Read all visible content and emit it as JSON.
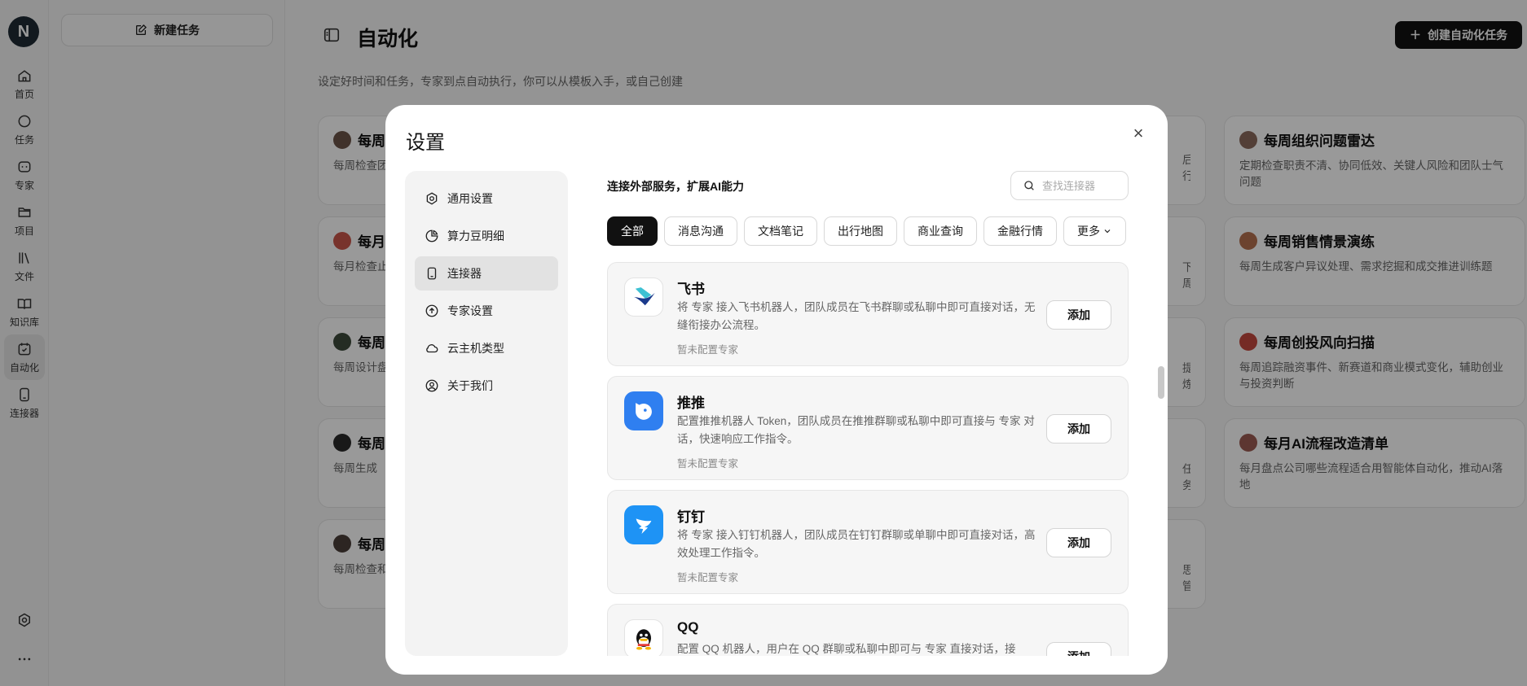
{
  "rail": {
    "logo": "N",
    "items": [
      {
        "label": "首页",
        "icon": "home-icon"
      },
      {
        "label": "任务",
        "icon": "chat-icon"
      },
      {
        "label": "专家",
        "icon": "bot-icon"
      },
      {
        "label": "项目",
        "icon": "folder-icon"
      },
      {
        "label": "文件",
        "icon": "books-icon"
      },
      {
        "label": "知识库",
        "icon": "book-open-icon"
      },
      {
        "label": "自动化",
        "icon": "calendar-check-icon"
      },
      {
        "label": "连接器",
        "icon": "tablet-icon"
      }
    ],
    "active": "自动化",
    "bottom": [
      "settings-icon",
      "more-dots-icon"
    ]
  },
  "sidebar": {
    "new_task": "新建任务"
  },
  "main": {
    "title": "自动化",
    "subtitle": "设定好时间和任务，专家到点自动执行，你可以从模板入手，或自己创建",
    "create_button": "创建自动化任务",
    "cards_left": [
      {
        "title": "每周",
        "desc": "每周检查团队在伪"
      },
      {
        "title": "每月",
        "desc": "每月检查止低价值"
      },
      {
        "title": "每周",
        "desc": "每周设计盘方式"
      },
      {
        "title": "每周",
        "desc": "每周生成"
      },
      {
        "title": "每周",
        "desc": "每周检查和安全短"
      }
    ],
    "cards_mid_fragments": [
      "后行",
      "下周",
      "提炼",
      "任务",
      "思管"
    ],
    "cards_right": [
      {
        "title": "每周组织问题雷达",
        "desc": "定期检查职责不清、协同低效、关键人风险和团队士气问题"
      },
      {
        "title": "每周销售情景演练",
        "desc": "每周生成客户异议处理、需求挖掘和成交推进训练题"
      },
      {
        "title": "每周创投风向扫描",
        "desc": "每周追踪融资事件、新赛道和商业模式变化，辅助创业与投资判断"
      },
      {
        "title": "每月AI流程改造清单",
        "desc": "每月盘点公司哪些流程适合用智能体自动化，推动AI落地"
      }
    ]
  },
  "modal": {
    "title": "设置",
    "nav": [
      {
        "label": "通用设置",
        "icon": "gear-icon"
      },
      {
        "label": "算力豆明细",
        "icon": "pie-chart-icon"
      },
      {
        "label": "连接器",
        "icon": "tablet-icon"
      },
      {
        "label": "专家设置",
        "icon": "upload-circle-icon"
      },
      {
        "label": "云主机类型",
        "icon": "cloud-icon"
      },
      {
        "label": "关于我们",
        "icon": "user-circle-icon"
      }
    ],
    "active_nav": "连接器",
    "heading": "连接外部服务，扩展AI能力",
    "search_placeholder": "查找连接器",
    "chips": [
      "全部",
      "消息沟通",
      "文档笔记",
      "出行地图",
      "商业查询",
      "金融行情",
      "更多"
    ],
    "active_chip": "全部",
    "connectors": [
      {
        "name": "飞书",
        "desc": "将 专家 接入飞书机器人，团队成员在飞书群聊或私聊中即可直接对话，无缝衔接办公流程。",
        "status": "暂未配置专家",
        "add": "添加",
        "icon": "feishu-icon"
      },
      {
        "name": "推推",
        "desc": "配置推推机器人 Token，团队成员在推推群聊或私聊中即可直接与 专家 对话，快速响应工作指令。",
        "status": "暂未配置专家",
        "add": "添加",
        "icon": "tuitui-icon"
      },
      {
        "name": "钉钉",
        "desc": "将 专家 接入钉钉机器人，团队成员在钉钉群聊或单聊中即可直接对话，高效处理工作指令。",
        "status": "暂未配置专家",
        "add": "添加",
        "icon": "dingtalk-icon"
      },
      {
        "name": "QQ",
        "desc": "配置 QQ 机器人，用户在 QQ 群聊或私聊中即可与 专家 直接对话，接",
        "status": "",
        "add": "添加",
        "icon": "qq-icon"
      }
    ]
  }
}
